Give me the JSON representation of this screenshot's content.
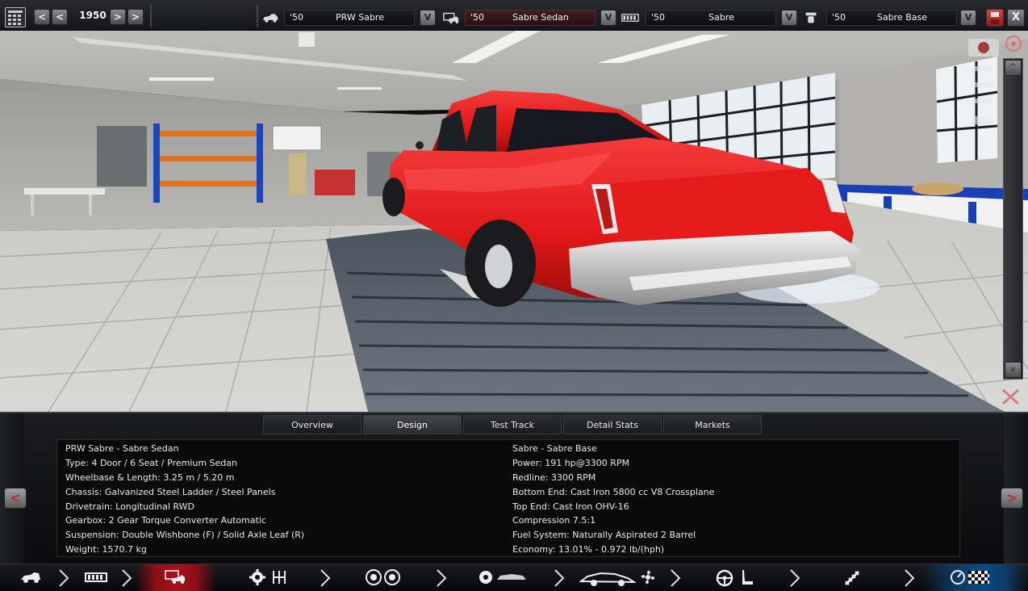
{
  "topbar": {
    "year": "1950",
    "prev_label": "<",
    "prev2_label": "<",
    "next_label": ">",
    "next2_label": ">",
    "selectors": [
      {
        "icon": "car-family-icon",
        "year": "'50",
        "name": "PRW Sabre",
        "dropdown": "V",
        "active": false
      },
      {
        "icon": "car-model-icon",
        "year": "'50",
        "name": "Sabre Sedan",
        "dropdown": "V",
        "active": true
      },
      {
        "icon": "engine-family-icon",
        "year": "'50",
        "name": "Sabre",
        "dropdown": "V",
        "active": false
      },
      {
        "icon": "engine-variant-icon",
        "year": "'50",
        "name": "Sabre Base",
        "dropdown": "V",
        "active": false
      }
    ],
    "close_label": "X"
  },
  "viewport": {
    "scroll_up": "^",
    "scroll_down": "v"
  },
  "panel": {
    "tabs": [
      {
        "label": "Overview",
        "active": false
      },
      {
        "label": "Design",
        "active": true
      },
      {
        "label": "Test Track",
        "active": false
      },
      {
        "label": "Detail Stats",
        "active": false
      },
      {
        "label": "Markets",
        "active": false
      }
    ],
    "left_arrow": "<",
    "right_arrow": ">",
    "car_info": [
      "PRW Sabre - Sabre Sedan",
      "Type: 4 Door / 6 Seat / Premium Sedan",
      "Wheelbase & Length: 3.25 m / 5.20 m",
      "Chassis: Galvanized Steel Ladder / Steel Panels",
      "Drivetrain: Longitudinal RWD",
      "Gearbox: 2 Gear Torque Converter Automatic",
      "Suspension: Double Wishbone (F) / Solid Axle Leaf (R)",
      "Weight: 1570.7 kg"
    ],
    "engine_info": [
      "Sabre - Sabre Base",
      "Power: 191 hp@3300 RPM",
      "Redline: 3300 RPM",
      "Bottom End: Cast Iron 5800 cc V8 Crossplane",
      "Top End: Cast Iron OHV-16",
      "Compression 7.5:1",
      "Fuel System: Naturally Aspirated 2 Barrel",
      "Economy: 13.01% - 0.972 lb/(hph)"
    ]
  },
  "toolbar": {
    "sections": [
      {
        "icons": [
          "car-body-icon"
        ],
        "active": false
      },
      {
        "icons": [
          "chassis-icon"
        ],
        "active": false
      },
      {
        "icons": [
          "car-trim-icon"
        ],
        "active": true
      },
      {
        "icons": [
          "gear-icon",
          "gearbox-icon"
        ],
        "active": false
      },
      {
        "icons": [
          "wheels-icon"
        ],
        "active": false
      },
      {
        "icons": [
          "tire-icon",
          "car-side-icon"
        ],
        "active": false
      },
      {
        "icons": [
          "car-aero-icon",
          "fan-icon"
        ],
        "active": false
      },
      {
        "icons": [
          "steering-wheel-icon",
          "seat-icon"
        ],
        "active": false
      },
      {
        "icons": [
          "spring-icon"
        ],
        "active": false
      },
      {
        "icons": [
          "dashboard-icon",
          "checkered-flag-icon"
        ],
        "active": false
      }
    ]
  },
  "colors": {
    "accent_red": "#c0262c",
    "car_red": "#e61b1b",
    "active_tab": "#45464c"
  }
}
